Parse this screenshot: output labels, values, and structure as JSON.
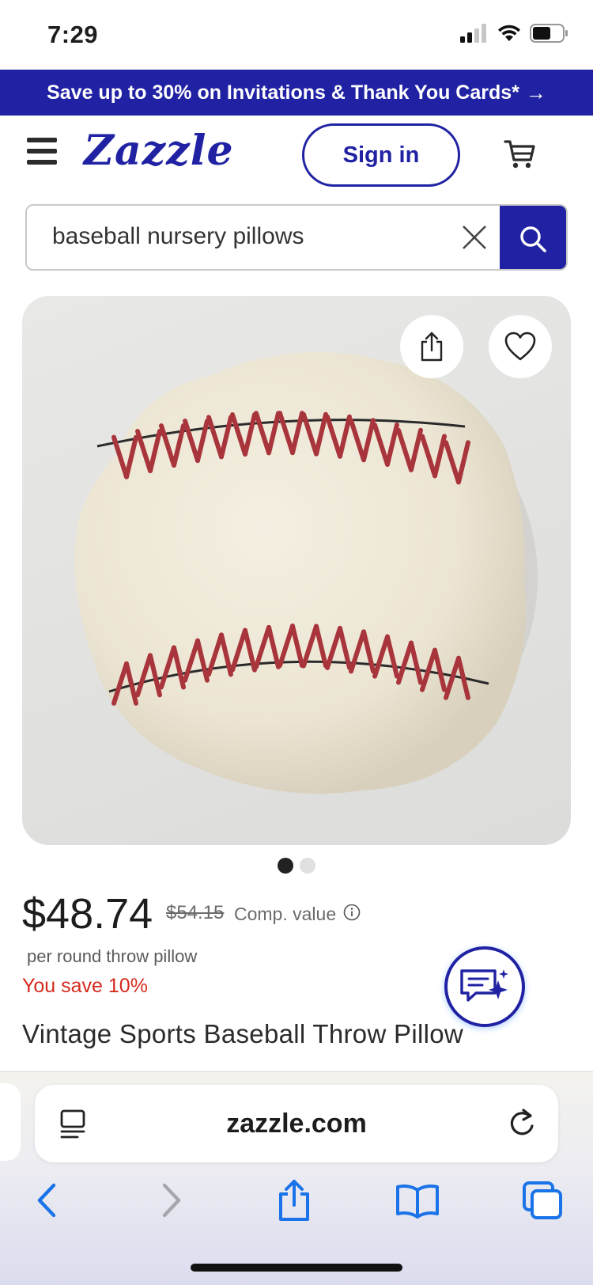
{
  "status_bar": {
    "time": "7:29"
  },
  "promo": {
    "text": "Save up to 30% on Invitations & Thank You Cards*",
    "arrow": "→"
  },
  "header": {
    "logo": "Zazzle",
    "sign_in": "Sign in"
  },
  "search": {
    "query": "baseball nursery pillows"
  },
  "product": {
    "price": "$48.74",
    "original_price": "$54.15",
    "comp_label": "Comp. value",
    "per_unit": "per round throw pillow",
    "savings": "You save 10%",
    "title": "Vintage Sports Baseball Throw Pillow",
    "image_dots": {
      "count": 2,
      "active": 0
    }
  },
  "browser": {
    "url": "zazzle.com"
  },
  "icons": {
    "menu": "hamburger-icon",
    "cart": "cart-icon",
    "clear": "close-icon",
    "search": "search-icon",
    "share": "share-icon",
    "favorite": "heart-icon",
    "info": "info-icon",
    "chat": "chat-sparkle-icon",
    "reader": "reader-icon",
    "reload": "reload-icon",
    "back": "chevron-left-icon",
    "forward": "chevron-right-icon",
    "bookmarks": "book-icon",
    "tabs": "tabs-icon"
  },
  "colors": {
    "brand": "#2022a3",
    "sale_red": "#d52b1e",
    "safari_blue": "#1a73e8"
  }
}
